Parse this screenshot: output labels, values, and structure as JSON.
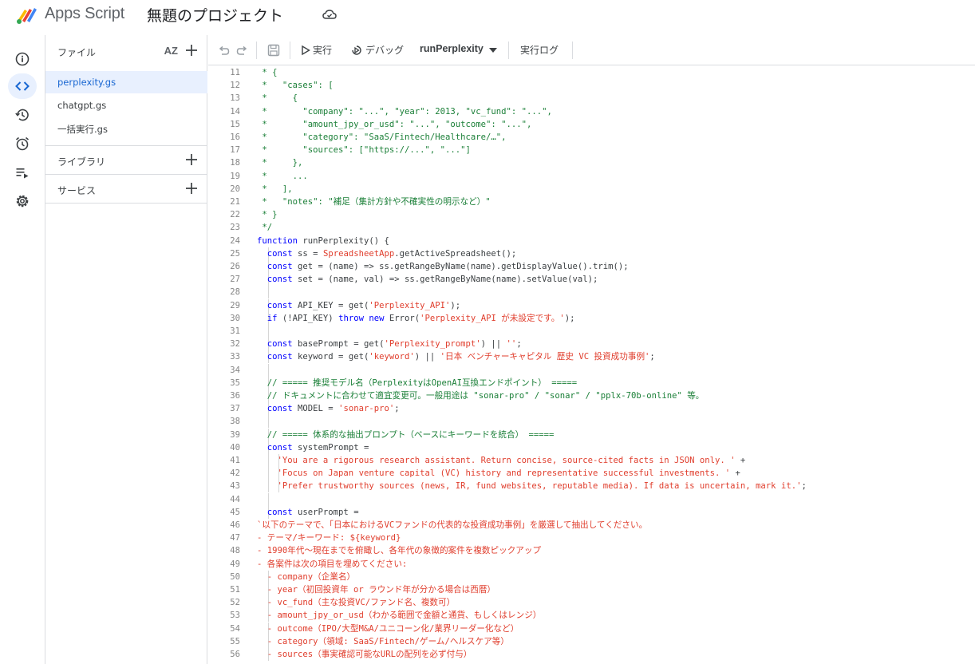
{
  "header": {
    "app_name": "Apps Script",
    "project_title": "無題のプロジェクト"
  },
  "rail": {
    "items": [
      "overview",
      "editor",
      "executions",
      "triggers",
      "executions-list",
      "settings"
    ],
    "active": "editor"
  },
  "files_panel": {
    "files_label": "ファイル",
    "sort_label": "AZ",
    "files": [
      {
        "name": "perplexity.gs",
        "active": true
      },
      {
        "name": "chatgpt.gs",
        "active": false
      },
      {
        "name": "一括実行.gs",
        "active": false
      }
    ],
    "libraries_label": "ライブラリ",
    "services_label": "サービス"
  },
  "toolbar": {
    "run_label": "実行",
    "debug_label": "デバッグ",
    "function_name": "runPerplexity",
    "log_label": "実行ログ"
  },
  "editor": {
    "lines": [
      {
        "n": "11",
        "t": " * {"
      },
      {
        "n": "12",
        "t": " *   \"cases\": ["
      },
      {
        "n": "13",
        "t": " *     {"
      },
      {
        "n": "14",
        "t": " *       \"company\": \"...\", \"year\": 2013, \"vc_fund\": \"...\","
      },
      {
        "n": "15",
        "t": " *       \"amount_jpy_or_usd\": \"...\", \"outcome\": \"...\","
      },
      {
        "n": "16",
        "t": " *       \"category\": \"SaaS/Fintech/Healthcare/…\","
      },
      {
        "n": "17",
        "t": " *       \"sources\": [\"https://...\", \"...\"]"
      },
      {
        "n": "18",
        "t": " *     },"
      },
      {
        "n": "19",
        "t": " *     ..."
      },
      {
        "n": "20",
        "t": " *   ],"
      },
      {
        "n": "21",
        "t": " *   \"notes\": \"補足（集計方針や不確実性の明示など）\""
      },
      {
        "n": "22",
        "t": " * }"
      },
      {
        "n": "23",
        "t": " */"
      },
      {
        "n": "24",
        "t": "function runPerplexity() {"
      },
      {
        "n": "25",
        "t": "  const ss = SpreadsheetApp.getActiveSpreadsheet();"
      },
      {
        "n": "26",
        "t": "  const get = (name) => ss.getRangeByName(name).getDisplayValue().trim();"
      },
      {
        "n": "27",
        "t": "  const set = (name, val) => ss.getRangeByName(name).setValue(val);"
      },
      {
        "n": "28",
        "t": ""
      },
      {
        "n": "29",
        "t": "  const API_KEY = get('Perplexity_API');"
      },
      {
        "n": "30",
        "t": "  if (!API_KEY) throw new Error('Perplexity_API が未設定です。');"
      },
      {
        "n": "31",
        "t": ""
      },
      {
        "n": "32",
        "t": "  const basePrompt = get('Perplexity_prompt') || '';"
      },
      {
        "n": "33",
        "t": "  const keyword = get('keyword') || '日本 ベンチャーキャピタル 歴史 VC 投資成功事例';"
      },
      {
        "n": "34",
        "t": ""
      },
      {
        "n": "35",
        "t": "  // ===== 推奨モデル名（PerplexityはOpenAI互換エンドポイント） ====="
      },
      {
        "n": "36",
        "t": "  // ドキュメントに合わせて適宜変更可。一般用途は \"sonar-pro\" / \"sonar\" / \"pplx-70b-online\" 等。"
      },
      {
        "n": "37",
        "t": "  const MODEL = 'sonar-pro';"
      },
      {
        "n": "38",
        "t": ""
      },
      {
        "n": "39",
        "t": "  // ===== 体系的な抽出プロンプト（ベースにキーワードを統合） ====="
      },
      {
        "n": "40",
        "t": "  const systemPrompt ="
      },
      {
        "n": "41",
        "t": "    'You are a rigorous research assistant. Return concise, source-cited facts in JSON only. ' +"
      },
      {
        "n": "42",
        "t": "    'Focus on Japan venture capital (VC) history and representative successful investments. ' +"
      },
      {
        "n": "43",
        "t": "    'Prefer trustworthy sources (news, IR, fund websites, reputable media). If data is uncertain, mark it.';"
      },
      {
        "n": "44",
        "t": ""
      },
      {
        "n": "45",
        "t": "  const userPrompt ="
      },
      {
        "n": "46",
        "t": "`以下のテーマで、「日本におけるVCファンドの代表的な投資成功事例」を厳選して抽出してください。"
      },
      {
        "n": "47",
        "t": "- テーマ/キーワード: ${keyword}"
      },
      {
        "n": "48",
        "t": "- 1990年代〜現在までを俯瞰し、各年代の象徴的案件を複数ピックアップ"
      },
      {
        "n": "49",
        "t": "- 各案件は次の項目を埋めてください:"
      },
      {
        "n": "50",
        "t": "  - company（企業名）"
      },
      {
        "n": "51",
        "t": "  - year（初回投資年 or ラウンド年が分かる場合は西暦）"
      },
      {
        "n": "52",
        "t": "  - vc_fund（主な投資VC/ファンド名、複数可）"
      },
      {
        "n": "53",
        "t": "  - amount_jpy_or_usd（わかる範囲で金額と通貨、もしくはレンジ）"
      },
      {
        "n": "54",
        "t": "  - outcome（IPO/大型M&A/ユニコーン化/業界リーダー化など）"
      },
      {
        "n": "55",
        "t": "  - category（領域: SaaS/Fintech/ゲーム/ヘルスケア等）"
      },
      {
        "n": "56",
        "t": "  - sources（事実確認可能なURLの配列を必ず付与）"
      }
    ]
  }
}
